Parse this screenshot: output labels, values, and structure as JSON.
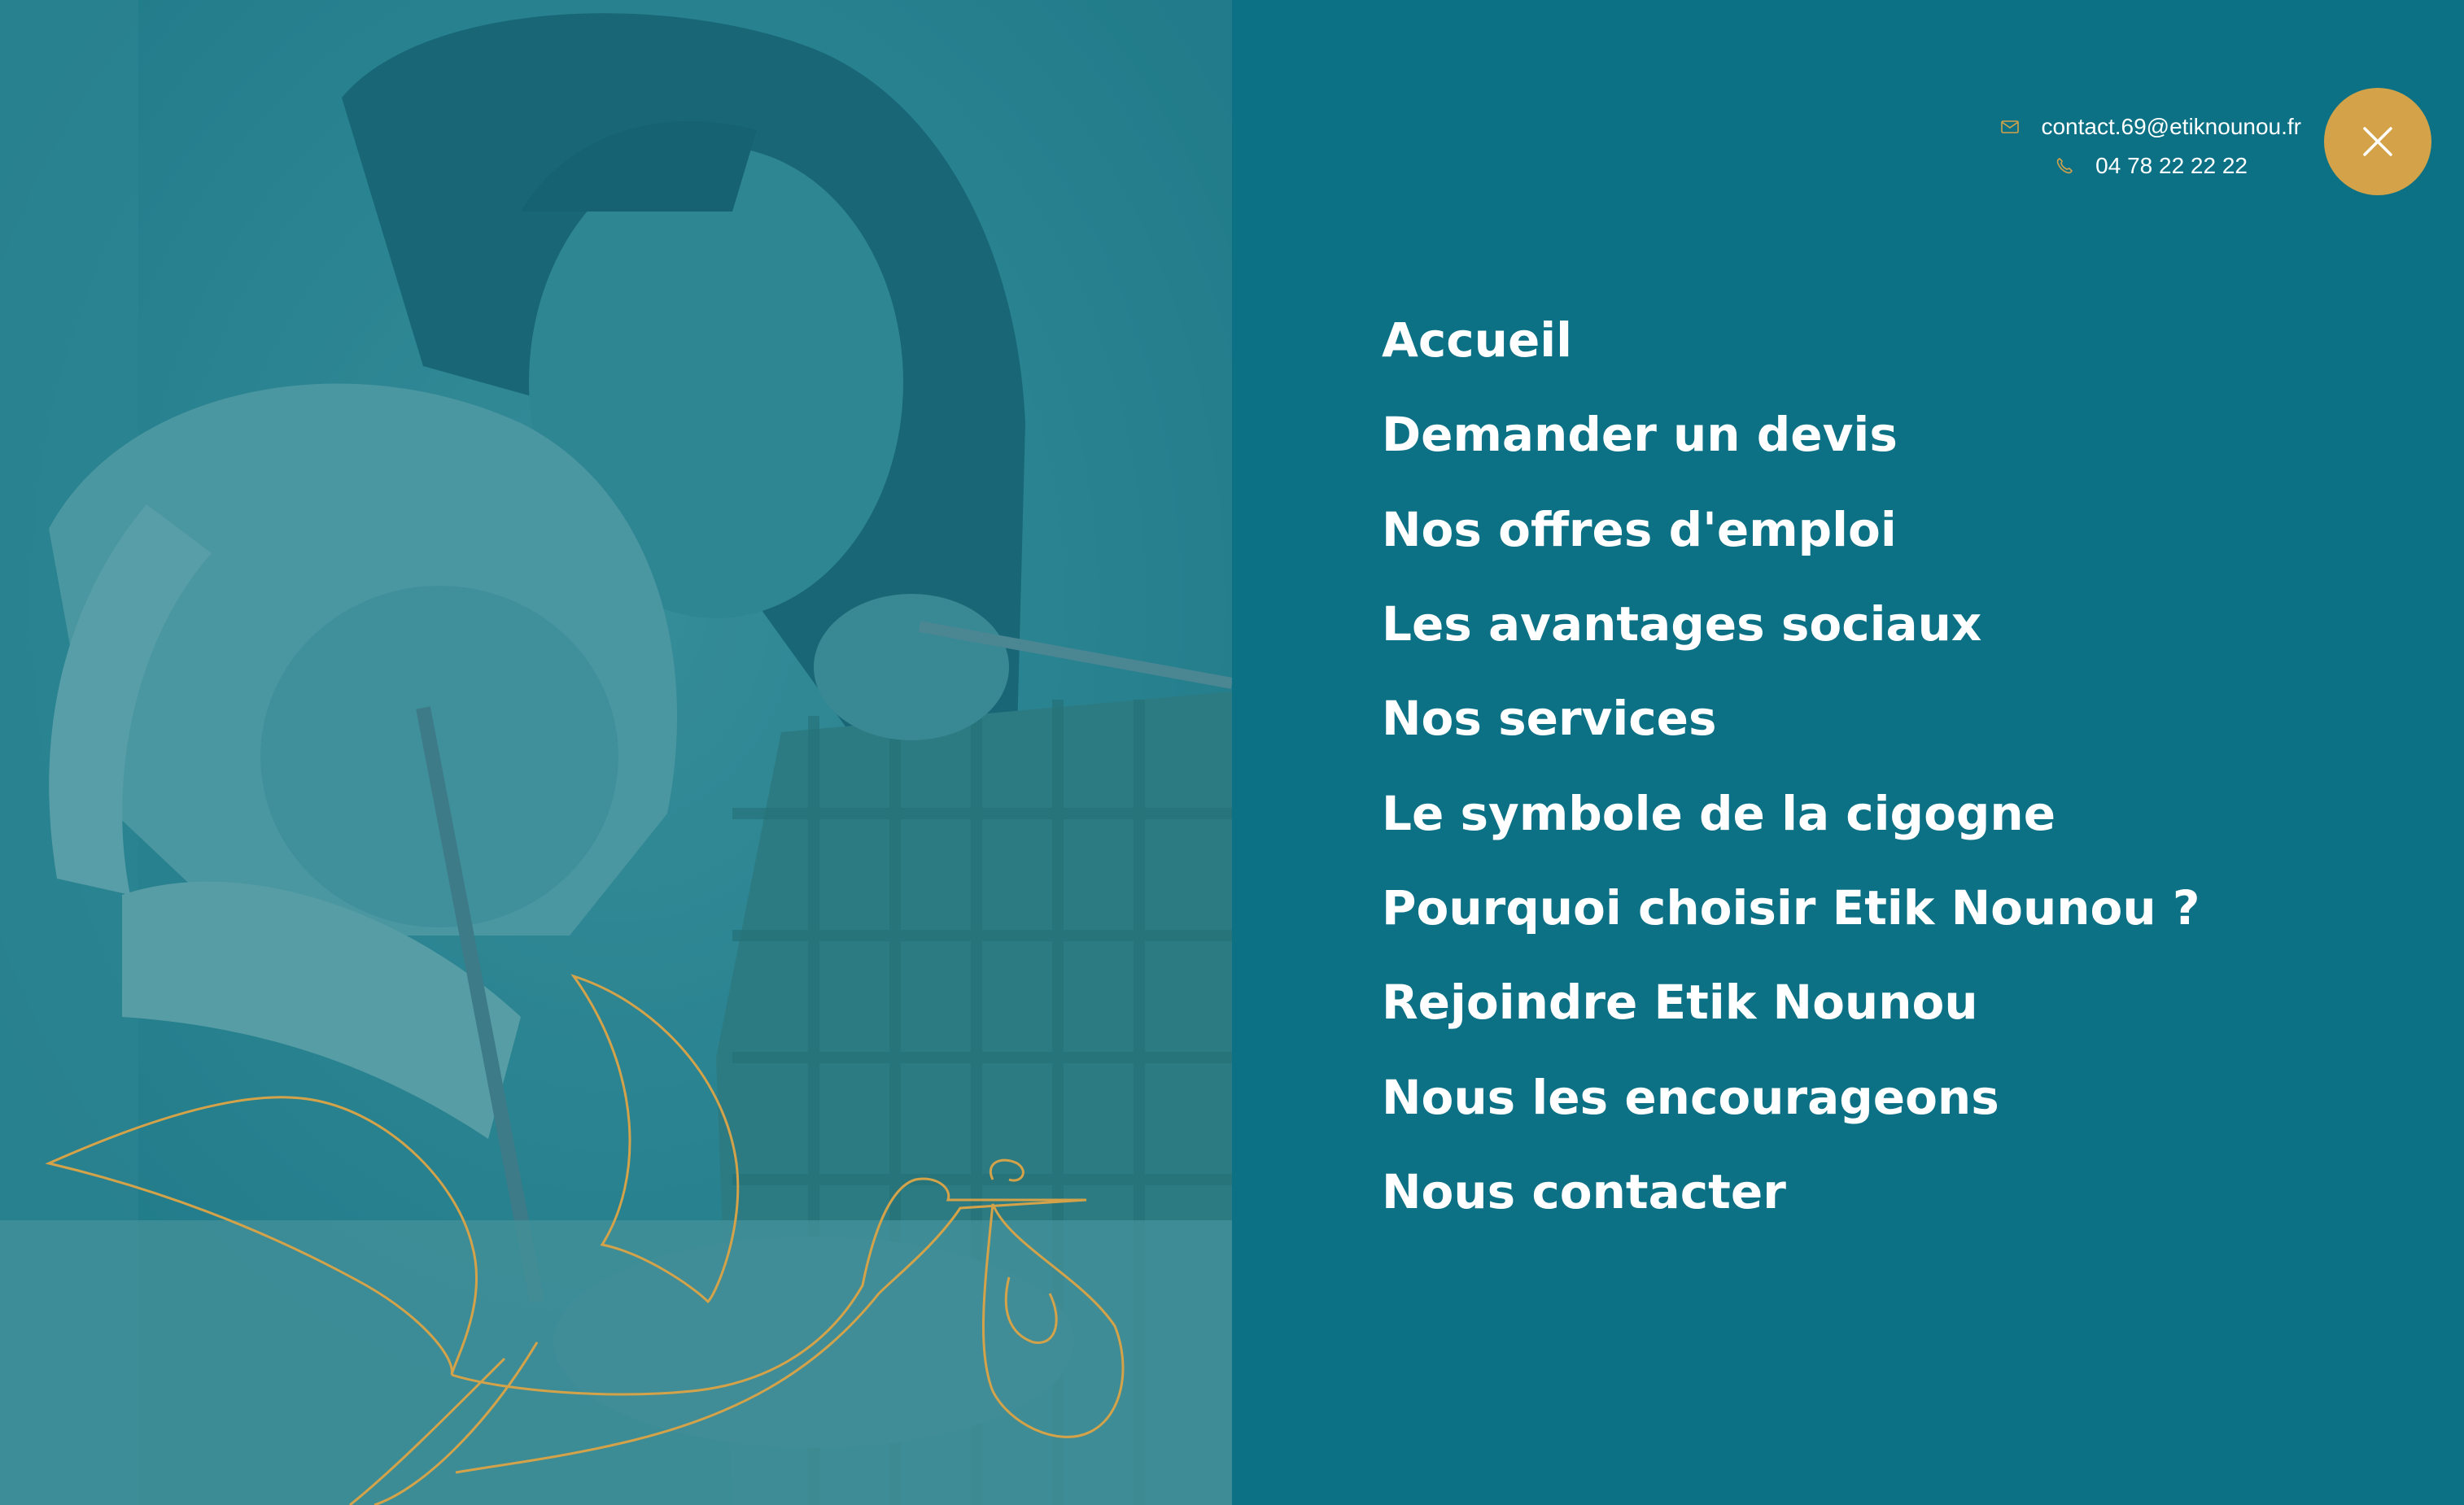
{
  "contact": {
    "email": "contact.69@etiknounou.fr",
    "phone": "04 78 22 22 22",
    "email_icon": "envelope-icon",
    "phone_icon": "phone-icon"
  },
  "close_button": {
    "icon": "close-icon"
  },
  "menu": {
    "items": [
      {
        "label": "Accueil"
      },
      {
        "label": "Demander un devis"
      },
      {
        "label": "Nos offres d'emploi"
      },
      {
        "label": "Les avantages sociaux"
      },
      {
        "label": "Nos services"
      },
      {
        "label": "Le symbole de la cigogne"
      },
      {
        "label": "Pourquoi choisir Etik Nounou ?"
      },
      {
        "label": "Rejoindre Etik Nounou"
      },
      {
        "label": "Nous les encourageons"
      },
      {
        "label": "Nous contacter"
      }
    ]
  },
  "colors": {
    "background": "#0c7185",
    "accent": "#d4a349",
    "text": "#ffffff",
    "photo_tint": "#2a8390"
  }
}
